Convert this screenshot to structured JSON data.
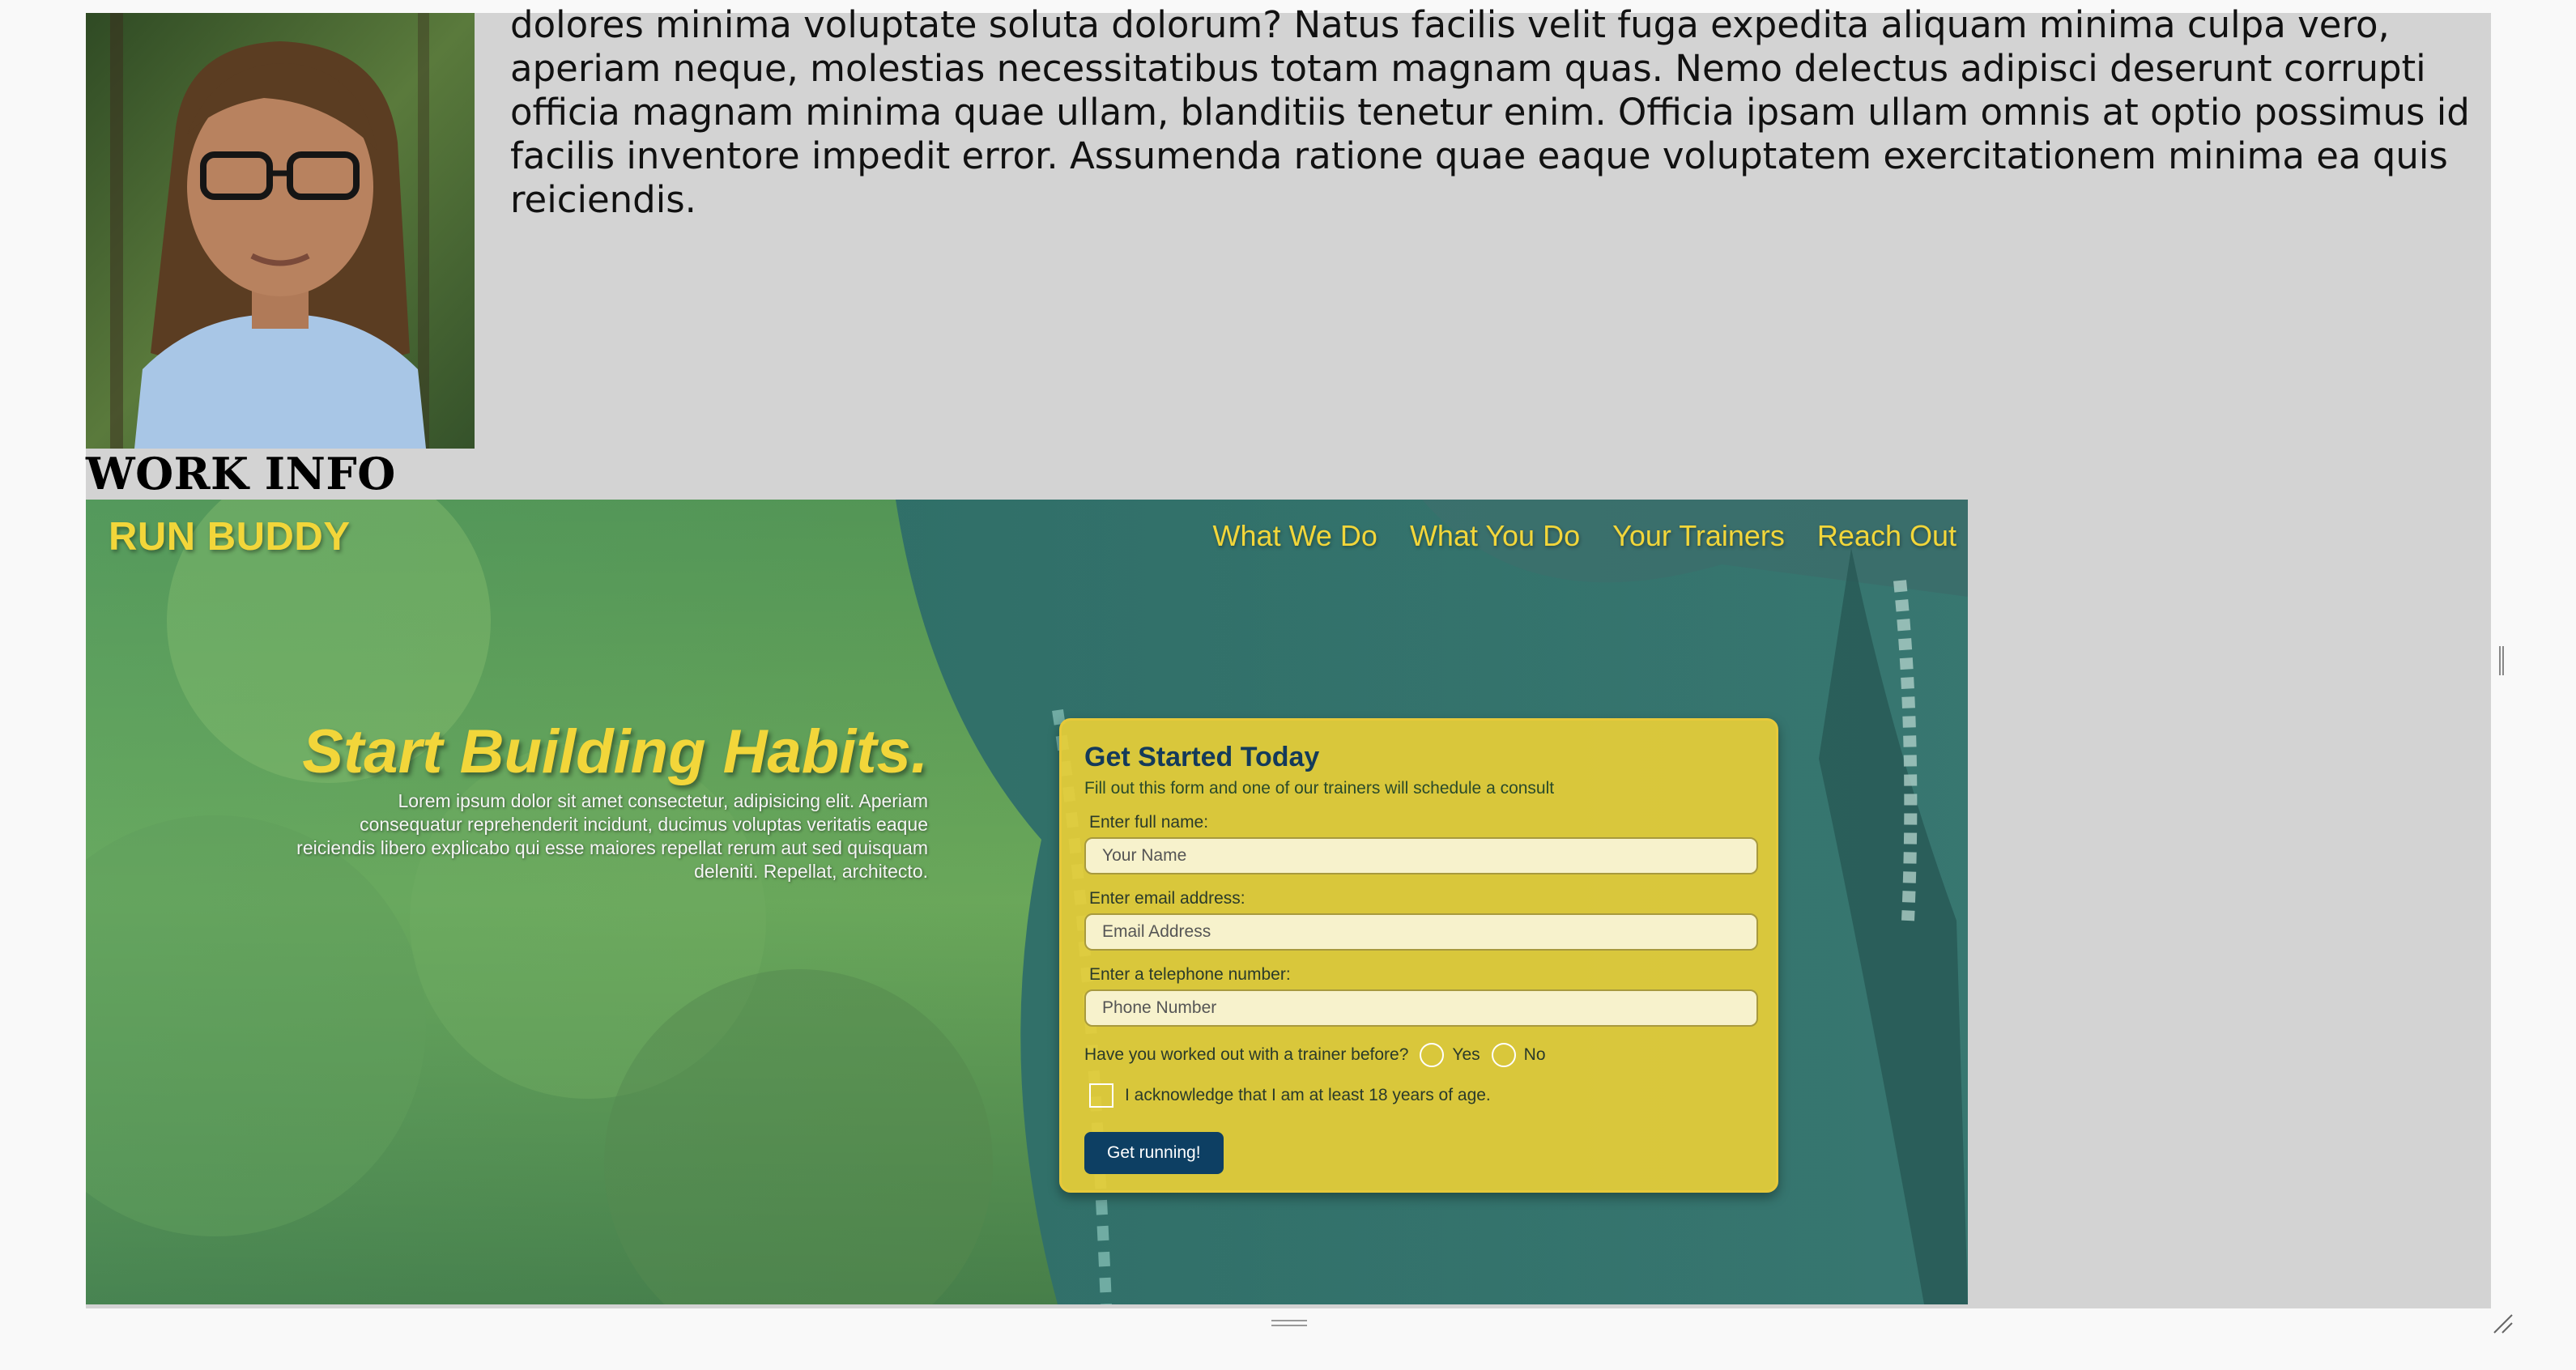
{
  "profile": {
    "bio": "dolores minima voluptate soluta dolorum? Natus facilis velit fuga expedita aliquam minima culpa vero, aperiam neque, molestias necessitatibus totam magnam quas. Nemo delectus adipisci deserunt corrupti officia magnam minima quae ullam, blanditiis tenetur enim. Officia ipsam ullam omnis at optio possimus id facilis inventore impedit error. Assumenda ratione quae eaque voluptatem exercitationem minima ea quis reiciendis."
  },
  "work": {
    "heading": "WORK INFO"
  },
  "preview": {
    "brand": "RUN BUDDY",
    "nav": [
      "What We Do",
      "What You Do",
      "Your Trainers",
      "Reach Out"
    ],
    "hero_heading": "Start Building Habits.",
    "hero_text": "Lorem ipsum dolor sit amet consectetur, adipisicing elit. Aperiam consequatur reprehenderit incidunt, ducimus voluptas veritatis eaque reiciendis libero explicabo qui esse maiores repellat rerum aut sed quisquam deleniti. Repellat, architecto.",
    "form": {
      "title": "Get Started Today",
      "subtitle": "Fill out this form and one of our trainers will schedule a consult",
      "name_label": "Enter full name:",
      "name_placeholder": "Your Name",
      "email_label": "Enter email address:",
      "email_placeholder": "Email Address",
      "phone_label": "Enter a telephone number:",
      "phone_placeholder": "Phone Number",
      "trainer_question": "Have you worked out with a trainer before?",
      "yes_label": "Yes",
      "no_label": "No",
      "ack_label": "I acknowledge that I am at least 18 years of age.",
      "submit_label": "Get running!"
    }
  },
  "colors": {
    "card_bg": "#d3d3d3",
    "brand_yellow": "#f2d63a",
    "form_bg": "#e7ce37",
    "button_bg": "#0d3f63"
  },
  "icons": [
    "scrollbar-grip-icon",
    "resize-handle-icon",
    "bottom-grip-icon"
  ]
}
